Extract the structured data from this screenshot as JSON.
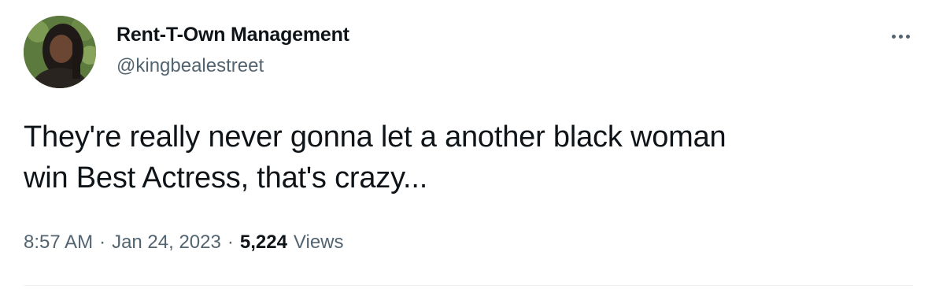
{
  "author": {
    "display_name": "Rent-T-Own Management",
    "handle": "@kingbealestreet",
    "avatar_icon": "profile-photo"
  },
  "menu": {
    "icon": "more-horizontal-icon"
  },
  "tweet": {
    "text_line1": "They're really never gonna let a another black woman",
    "text_line2": "win Best Actress, that's crazy..."
  },
  "meta": {
    "time": "8:57 AM",
    "separator": "·",
    "date": "Jan 24, 2023",
    "views_count": "5,224",
    "views_label": "Views"
  },
  "colors": {
    "text_primary": "#0f1419",
    "text_secondary": "#536471",
    "divider": "#eff3f4"
  }
}
